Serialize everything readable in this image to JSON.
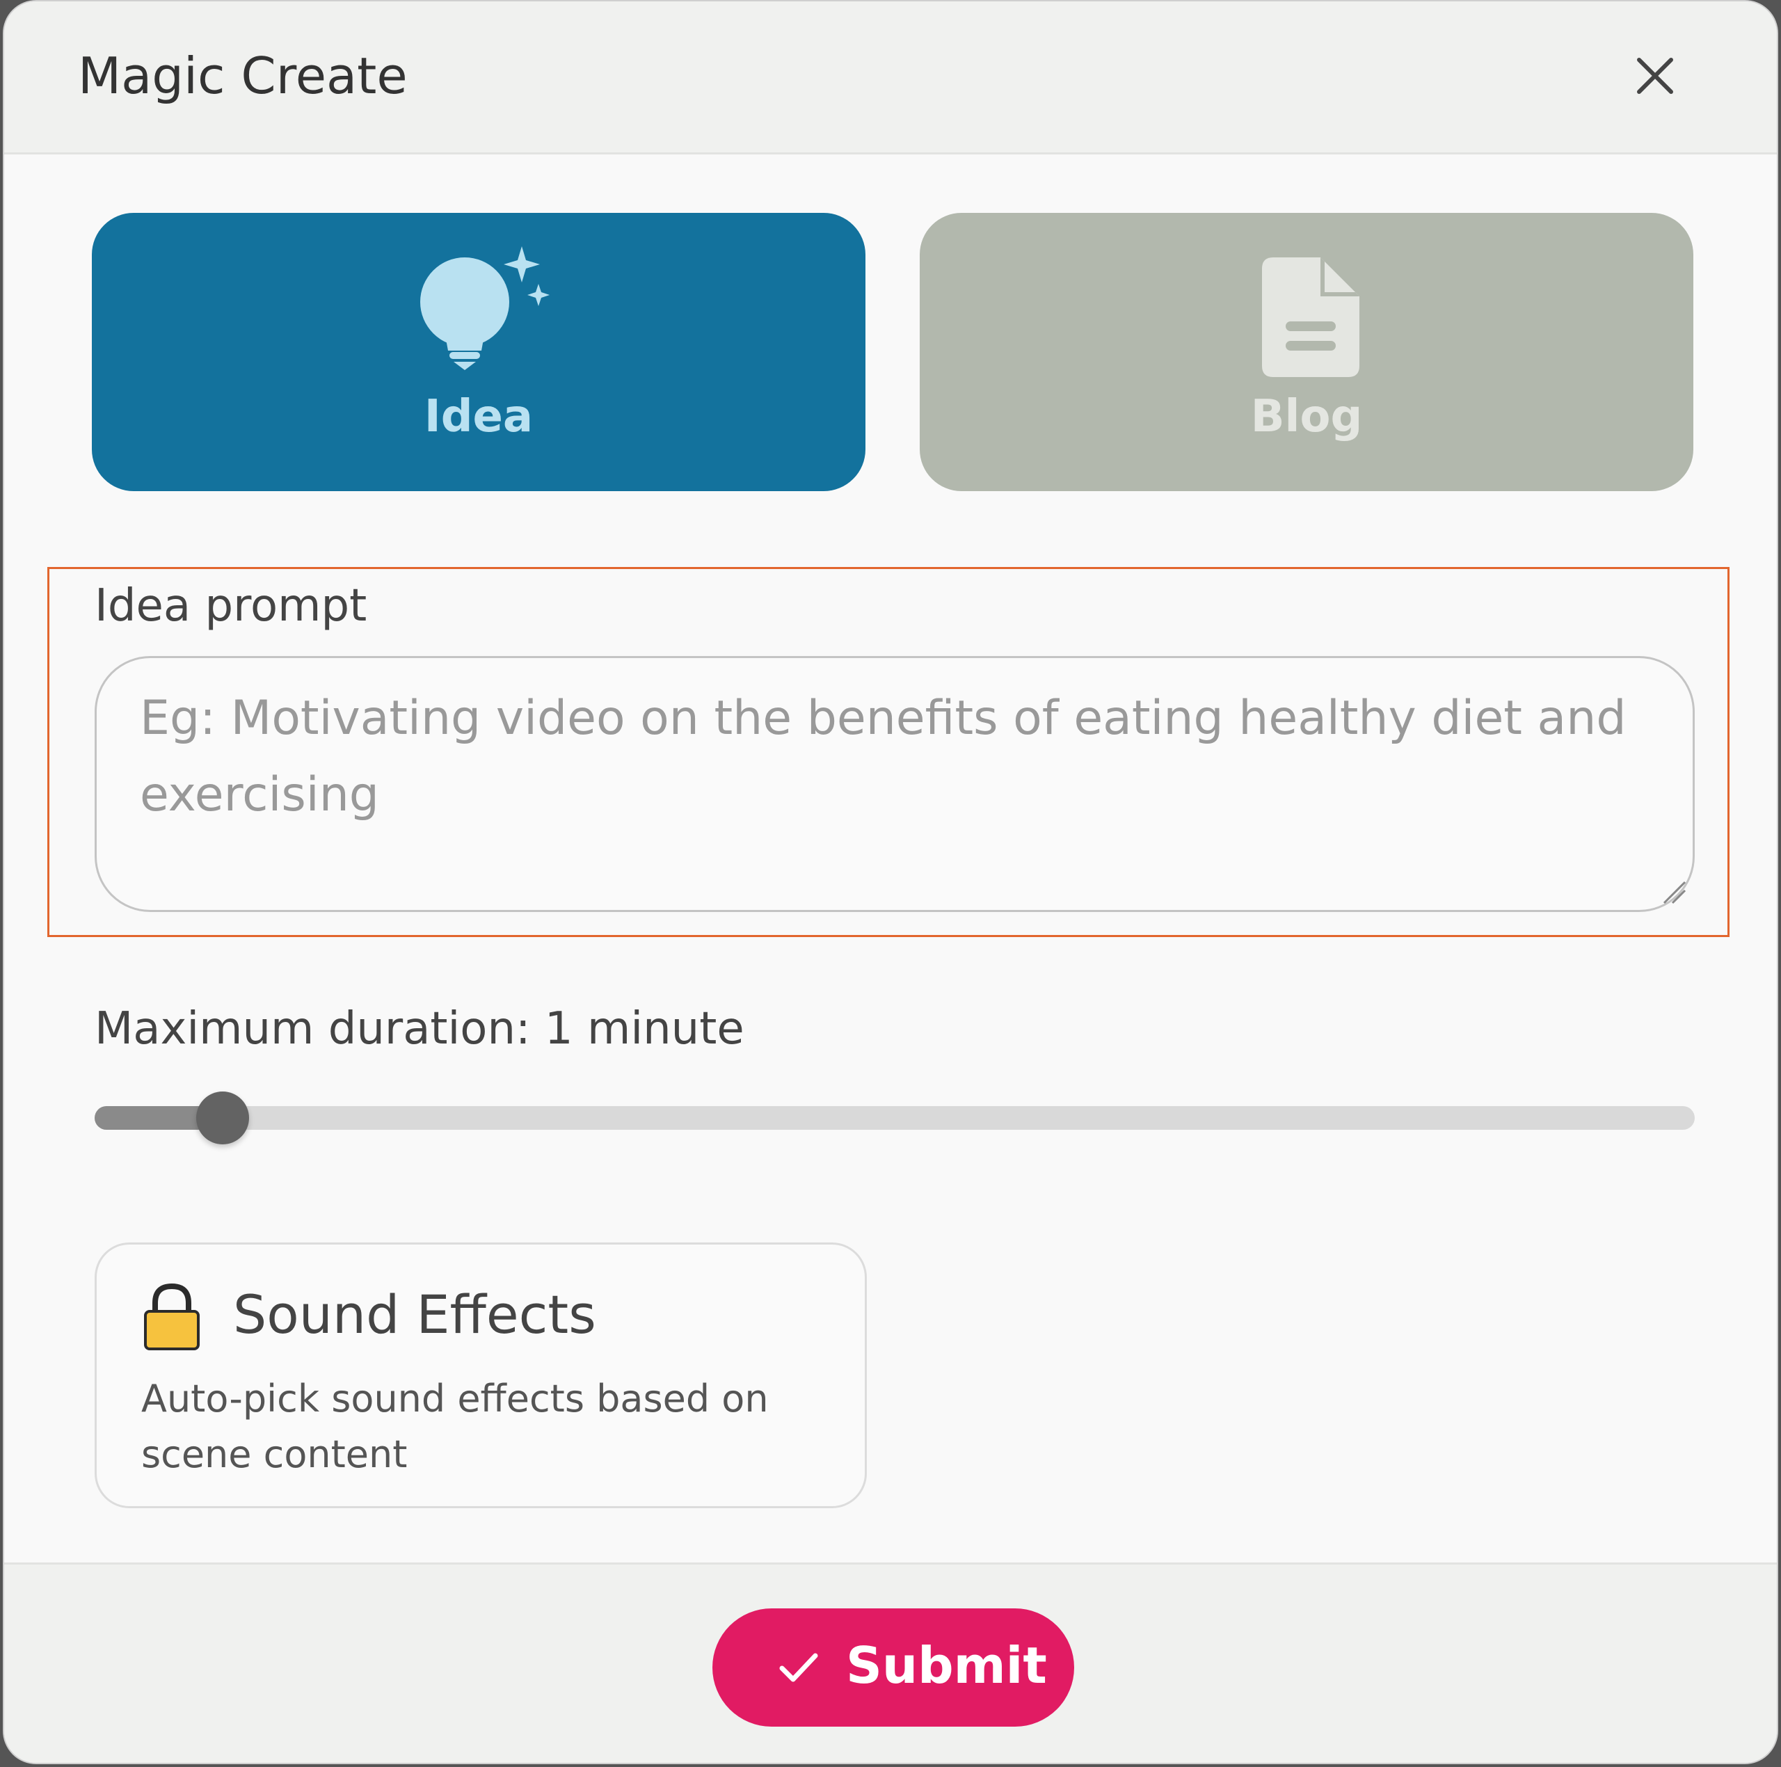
{
  "dialog": {
    "title": "Magic Create",
    "close_icon": "close-icon"
  },
  "modes": [
    {
      "label": "Idea",
      "icon": "lightbulb-sparkle-icon",
      "selected": true,
      "color": "#13729d"
    },
    {
      "label": "Blog",
      "icon": "document-icon",
      "selected": false,
      "color": "#b2b8ad"
    }
  ],
  "prompt": {
    "label": "Idea prompt",
    "value": "",
    "placeholder": "Eg: Motivating video on the benefits of eating healthy diet and exercising"
  },
  "duration": {
    "label": "Maximum duration: 1 minute",
    "slider_fraction": 0.08
  },
  "sound_effects": {
    "title": "Sound Effects",
    "description": "Auto-pick sound effects based on scene content",
    "icon": "lock-icon",
    "locked": true
  },
  "footer": {
    "submit_label": "Submit",
    "submit_icon": "check-icon",
    "submit_color": "#e11b63"
  }
}
